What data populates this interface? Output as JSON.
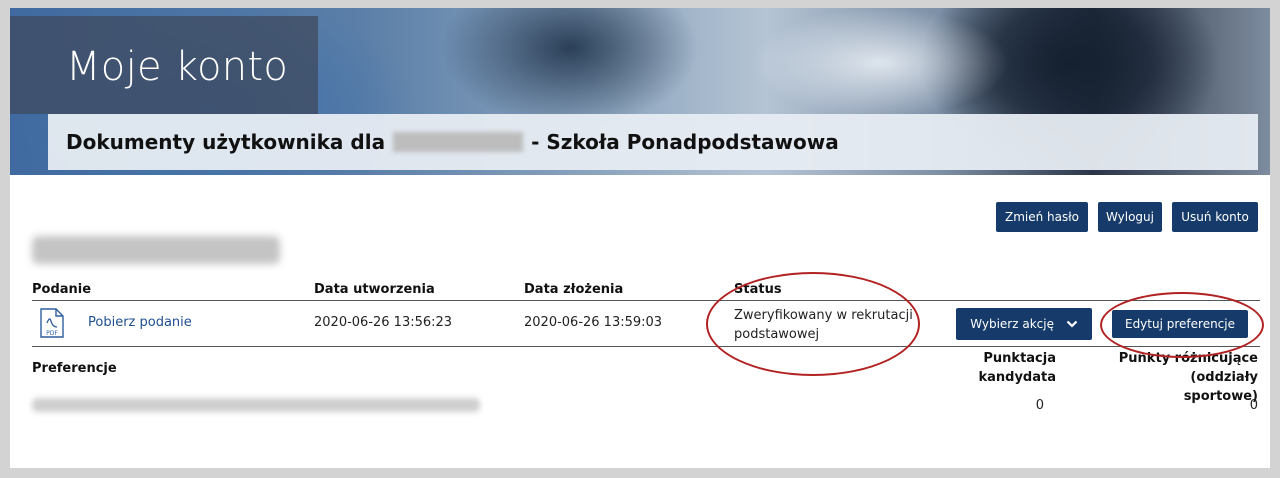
{
  "header": {
    "title": "Moje konto",
    "subtitle_prefix": "Dokumenty użytkownika dla",
    "subtitle_suffix": "- Szkoła Ponadpodstawowa"
  },
  "account_buttons": {
    "change_password": "Zmień hasło",
    "logout": "Wyloguj",
    "delete_account": "Usuń konto"
  },
  "table": {
    "headers": {
      "podanie": "Podanie",
      "created": "Data utworzenia",
      "submitted": "Data złożenia",
      "status": "Status"
    },
    "row": {
      "download_link": "Pobierz podanie",
      "created": "2020-06-26 13:56:23",
      "submitted": "2020-06-26 13:59:03",
      "status_line1": "Zweryfikowany w rekrutacji",
      "status_line2": "podstawowej",
      "action_dropdown": "Wybierz akcję",
      "edit_preferences": "Edytuj preferencje"
    }
  },
  "preferences": {
    "label": "Preferencje",
    "score_header_line1": "Punktacja",
    "score_header_line2": "kandydata",
    "diff_header_line1": "Punkty różnicujące (oddziały",
    "diff_header_line2": "sportowe)",
    "score_value": "0",
    "diff_value": "0"
  },
  "colors": {
    "button_bg": "#163a6a",
    "highlight_ellipse": "#b22222"
  },
  "icons": {
    "pdf": "pdf-file-icon",
    "dropdown": "chevron-down-icon"
  }
}
